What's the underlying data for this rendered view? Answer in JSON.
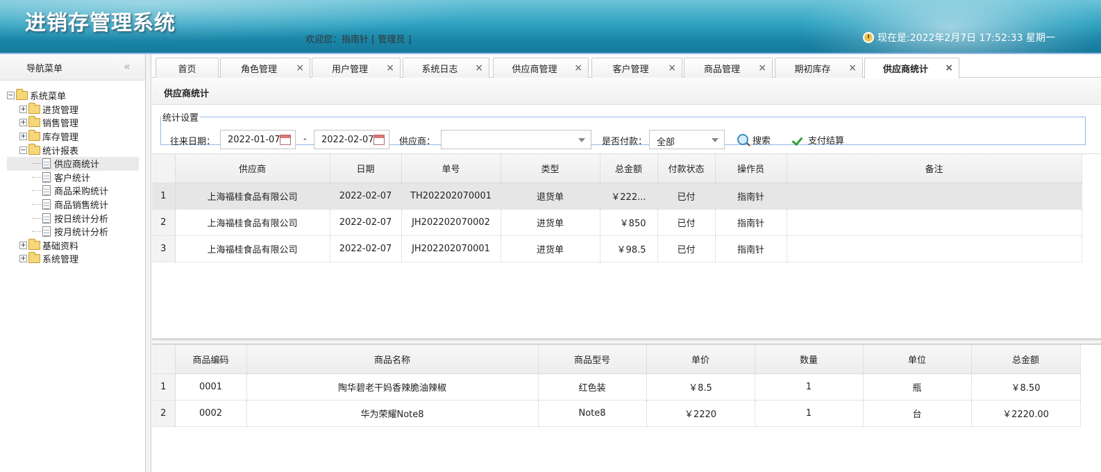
{
  "header": {
    "app_title": "进销存管理系统",
    "welcome": "欢迎您：指南针 [ 管理员 ]",
    "clock": "现在是:2022年2月7日 17:52:33 星期一"
  },
  "sidebar": {
    "title": "导航菜单",
    "collapse_glyph": "«",
    "tree": [
      {
        "label": "系统菜单",
        "level": 0,
        "kind": "folder-open",
        "expander": "−"
      },
      {
        "label": "进货管理",
        "level": 1,
        "kind": "folder",
        "expander": "+"
      },
      {
        "label": "销售管理",
        "level": 1,
        "kind": "folder",
        "expander": "+"
      },
      {
        "label": "库存管理",
        "level": 1,
        "kind": "folder",
        "expander": "+"
      },
      {
        "label": "统计报表",
        "level": 1,
        "kind": "folder-open",
        "expander": "−"
      },
      {
        "label": "供应商统计",
        "level": 2,
        "kind": "doc",
        "selected": true
      },
      {
        "label": "客户统计",
        "level": 2,
        "kind": "doc"
      },
      {
        "label": "商品采购统计",
        "level": 2,
        "kind": "doc"
      },
      {
        "label": "商品销售统计",
        "level": 2,
        "kind": "doc"
      },
      {
        "label": "按日统计分析",
        "level": 2,
        "kind": "doc"
      },
      {
        "label": "按月统计分析",
        "level": 2,
        "kind": "doc"
      },
      {
        "label": "基础资料",
        "level": 1,
        "kind": "folder",
        "expander": "+"
      },
      {
        "label": "系统管理",
        "level": 1,
        "kind": "folder",
        "expander": "+"
      }
    ]
  },
  "tabs": [
    {
      "label": "首页",
      "closable": false
    },
    {
      "label": "角色管理",
      "closable": true
    },
    {
      "label": "用户管理",
      "closable": true
    },
    {
      "label": "系统日志",
      "closable": true
    },
    {
      "label": "供应商管理",
      "closable": true
    },
    {
      "label": "客户管理",
      "closable": true
    },
    {
      "label": "商品管理",
      "closable": true
    },
    {
      "label": "期初库存",
      "closable": true
    },
    {
      "label": "供应商统计",
      "closable": true,
      "active": true
    }
  ],
  "close_glyph": "×",
  "panel_title": "供应商统计",
  "filters": {
    "legend": "统计设置",
    "date_label": "往来日期：",
    "date_from": "2022-01-07",
    "date_sep": "-",
    "date_to": "2022-02-07",
    "supplier_label": "供应商：",
    "supplier_value": "",
    "paid_label": "是否付款：",
    "paid_value": "全部",
    "search_label": "搜索",
    "settle_label": "支付结算"
  },
  "orders_grid": {
    "columns": [
      "供应商",
      "日期",
      "单号",
      "类型",
      "总金额",
      "付款状态",
      "操作员",
      "备注"
    ],
    "rows": [
      {
        "n": "1",
        "cells": [
          "上海福桂食品有限公司",
          "2022-02-07",
          "TH202202070001",
          "退货单",
          "￥222...",
          "已付",
          "指南针",
          ""
        ]
      },
      {
        "n": "2",
        "cells": [
          "上海福桂食品有限公司",
          "2022-02-07",
          "JH202202070002",
          "进货单",
          "￥850",
          "已付",
          "指南针",
          ""
        ]
      },
      {
        "n": "3",
        "cells": [
          "上海福桂食品有限公司",
          "2022-02-07",
          "JH202202070001",
          "进货单",
          "￥98.5",
          "已付",
          "指南针",
          ""
        ]
      }
    ]
  },
  "items_grid": {
    "columns": [
      "商品编码",
      "商品名称",
      "商品型号",
      "单价",
      "数量",
      "单位",
      "总金额"
    ],
    "rows": [
      {
        "n": "1",
        "cells": [
          "0001",
          "陶华碧老干妈香辣脆油辣椒",
          "红色装",
          "￥8.5",
          "1",
          "瓶",
          "￥8.50"
        ]
      },
      {
        "n": "2",
        "cells": [
          "0002",
          "华为荣耀Note8",
          "Note8",
          "￥2220",
          "1",
          "台",
          "￥2220.00"
        ]
      }
    ]
  }
}
